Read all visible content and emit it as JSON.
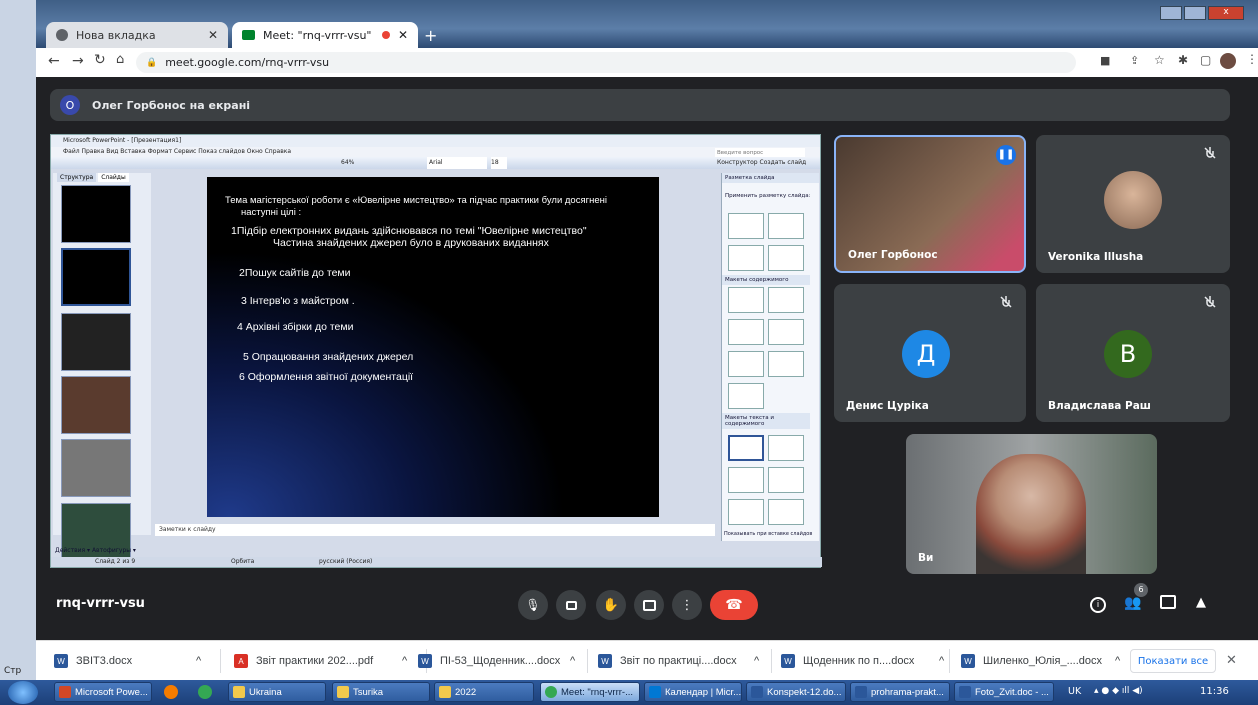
{
  "browser": {
    "tabs": [
      {
        "label": "Нова вкладка"
      },
      {
        "label": "Meet: \"rnq-vrrr-vsu\""
      }
    ],
    "url": "meet.google.com/rnq-vrrr-vsu"
  },
  "meet": {
    "presenting_banner": "Олег Горбонос на екрані",
    "presenter_initial": "О",
    "meeting_code": "rnq-vrrr-vsu",
    "participant_count": "6",
    "participants": [
      {
        "name": "Олег Горбонос",
        "type": "video"
      },
      {
        "name": "Veronika Illusha",
        "type": "video",
        "muted": true
      },
      {
        "name": "Денис Цуріка",
        "initial": "Д",
        "color": "#1e88e5",
        "muted": true
      },
      {
        "name": "Владислава Раш",
        "initial": "В",
        "color": "#33691e",
        "muted": true
      },
      {
        "name": "Ви",
        "type": "video"
      }
    ]
  },
  "powerpoint": {
    "title": "Microsoft PowerPoint - [Презентация1]",
    "menu": "Файл  Правка  Вид  Вставка  Формат  Сервис  Показ слайдов  Окно  Справка",
    "font": "Arial",
    "size": "18",
    "zoom": "64%",
    "tabs": [
      "Структура",
      "Слайды"
    ],
    "help_placeholder": "Введите вопрос",
    "toolbar_right": "Конструктор  Создать слайд",
    "slide_lines": [
      "Тема магістерської роботи є «Ювелірне мистецтво» та підчас практики були досягнені",
      "наступні цілі :",
      "1Підбір електронних видань здійснювався по темі \"Ювелірне мистецтво\"",
      "Частина знайдених джерел було  в друкованих виданнях",
      "2Пошук сайтів до теми",
      "3 Інтерв'ю з майстром .",
      "4 Архівні збірки до теми",
      "5 Опрацювання знайдених джерел",
      "6 Оформлення звітної  документації"
    ],
    "notes_placeholder": "Заметки к слайду",
    "task_pane": {
      "title": "Разметка слайда",
      "apply_label": "Применить разметку слайда:",
      "section1": "Макеты содержимого",
      "section2": "Макеты текста и содержимого",
      "footer": "Показывать при вставке слайдов"
    },
    "status": {
      "slide": "Слайд 2 из 9",
      "design": "Орбита",
      "lang": "русский (Россия)"
    },
    "drawing_bar": "Действия ▾   Автофигуры ▾"
  },
  "downloads": [
    {
      "name": "ЗВІТ3.docx",
      "kind": "word"
    },
    {
      "name": "Звіт практики 202....pdf",
      "kind": "pdf"
    },
    {
      "name": "ПІ-53_Щоденник....docx",
      "kind": "word"
    },
    {
      "name": "Звіт по практиці....docx",
      "kind": "word"
    },
    {
      "name": "Щоденник по п....docx",
      "kind": "word"
    },
    {
      "name": "Шиленко_Юлія_....docx",
      "kind": "word"
    }
  ],
  "downloads_show_all": "Показати все",
  "taskbar": {
    "items": [
      "Microsoft Powe...",
      "Ukraina",
      "Tsurika",
      "2022",
      "Meet: \"rnq-vrrr-...",
      "Календар | Micr...",
      "Konspekt-12.do...",
      "prohrama-prakt...",
      "Foto_Zvit.doc - ..."
    ],
    "lang": "UK",
    "clock": "11:36"
  },
  "left_strip": {
    "label": "Стр"
  }
}
